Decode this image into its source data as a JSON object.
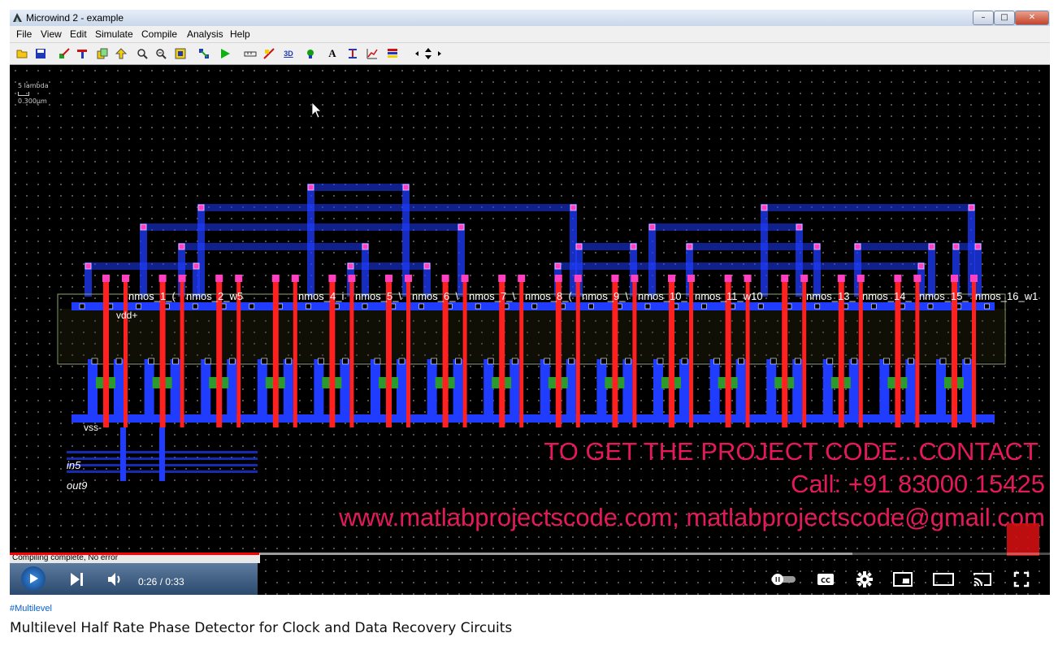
{
  "window": {
    "title": "Microwind 2 - example",
    "controls": {
      "minimize": "–",
      "maximize": "□",
      "close": "✕"
    }
  },
  "menu": [
    "File",
    "View",
    "Edit",
    "Simulate",
    "Compile",
    "Analysis",
    "Help"
  ],
  "toolbar_icons": [
    "open-icon",
    "save-icon",
    "draw-icon",
    "generator-icon",
    "copy-icon",
    "stretch-icon",
    "zoom-in-icon",
    "zoom-out-icon",
    "view-all-icon",
    "connection-icon",
    "run-simulation-icon",
    "measure-icon",
    "cut-icon",
    "3d-view-icon",
    "node-icon",
    "text-icon",
    "process-icon",
    "graph-icon",
    "layers-icon",
    "navigate-icon"
  ],
  "toolbar_text": {
    "text_tool": "A",
    "three_d": "3D"
  },
  "canvas": {
    "scale_top": "5 lambda",
    "scale_bottom": "0.300µm",
    "labels": {
      "vdd": "vdd+",
      "vss": "vss-",
      "in5": "in5",
      "out9": "out9",
      "nmos": [
        "nmos_1_(",
        "nmos_2_w5",
        "nmos_4_i",
        "nmos_5_\\",
        "nmos_6_\\",
        "nmos_7_\\",
        "nmos_8_(",
        "nmos_9_\\",
        "nmos_10_",
        "nmos_11_w10",
        "nmos_13_",
        "nmos_14_",
        "nmos_15_",
        "nmos_16_w1"
      ]
    }
  },
  "overlay": {
    "line1": "TO GET THE PROJECT CODE...CONTACT",
    "line2": "Call: +91 83000 15425",
    "line3": "www.matlabprojectscode.com; matlabprojectscode@gmail.com"
  },
  "status": "Compiling complete, No error",
  "player": {
    "current_time": "0:26",
    "duration": "0:33",
    "time_display": "0:26 / 0:33",
    "progress": 0.24,
    "buffered": 0.81,
    "icons": [
      "play-icon",
      "next-icon",
      "volume-icon",
      "autoplay-toggle-icon",
      "captions-icon",
      "settings-icon",
      "miniplayer-icon",
      "theater-mode-icon",
      "cast-icon",
      "fullscreen-icon"
    ]
  },
  "hashtag": "#Multilevel",
  "video_title": "Multilevel Half Rate Phase Detector for Clock and Data Recovery Circuits",
  "colors": {
    "metal": "#1f3cff",
    "poly": "#ff2020",
    "contact": "#ff40c0",
    "overlay_text": "#e5195a",
    "progress": "#ff0000"
  }
}
